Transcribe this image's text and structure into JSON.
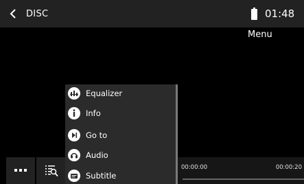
{
  "header": {
    "title": "DISC",
    "time": "01:48"
  },
  "menu_label": "Menu",
  "popup": {
    "items": [
      {
        "label": "Equalizer",
        "icon": "equalizer-icon"
      },
      {
        "label": "Info",
        "icon": "info-icon"
      },
      {
        "label": "Go to",
        "icon": "goto-icon"
      },
      {
        "label": "Audio",
        "icon": "audio-icon"
      },
      {
        "label": "Subtitle",
        "icon": "subtitle-icon"
      }
    ]
  },
  "playback": {
    "elapsed": "00:00:00",
    "total": "00:00:20",
    "progress": 0
  },
  "colors": {
    "bar_bg": "#222222",
    "popup_bg": "#2b2b2b",
    "text": "#ffffff"
  }
}
